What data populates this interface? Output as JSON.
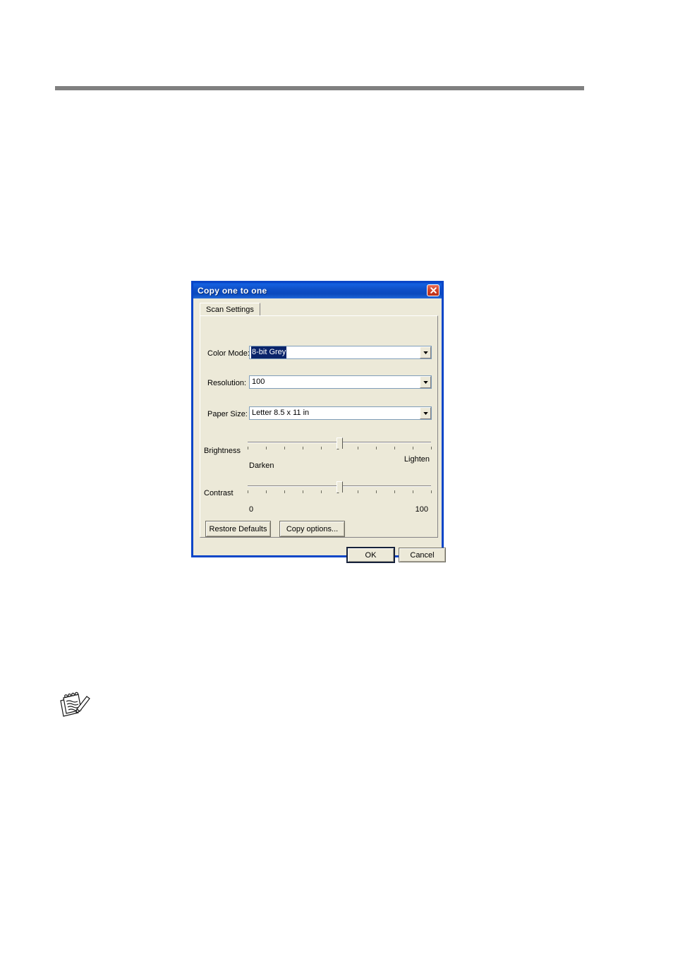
{
  "page": {
    "rule_color": "#808080",
    "background": "#ffffff",
    "note_icon": "notepad-pencil-icon"
  },
  "dialog": {
    "title": "Copy one to one",
    "close_icon": "close-icon",
    "accent_titlebar": "#0b49bd",
    "face_color": "#ece9d8",
    "tabs": [
      {
        "label": "Scan Settings",
        "active": true
      }
    ],
    "fields": [
      {
        "label": "Color Mode:",
        "value": "8-bit Grey",
        "selected": true,
        "control": "combobox",
        "arrow_icon": "chevron-down-icon"
      },
      {
        "label": "Resolution:",
        "value": "100",
        "selected": false,
        "control": "combobox",
        "arrow_icon": "chevron-down-icon"
      },
      {
        "label": "Paper Size:",
        "value": "Letter  8.5 x 11 in",
        "selected": false,
        "control": "combobox",
        "arrow_icon": "chevron-down-icon"
      }
    ],
    "sliders": [
      {
        "label": "Brightness",
        "min_caption": "Darken",
        "max_caption": "Lighten",
        "value": 50,
        "min": 0,
        "max": 100,
        "ticks": 11
      },
      {
        "label": "Contrast",
        "min_caption": "0",
        "max_caption": "100",
        "value": 50,
        "min": 0,
        "max": 100,
        "ticks": 11
      }
    ],
    "panel_buttons": [
      {
        "label": "Restore Defaults"
      },
      {
        "label": "Copy options..."
      }
    ],
    "footer_buttons": [
      {
        "label": "OK",
        "default": true
      },
      {
        "label": "Cancel",
        "default": false
      }
    ]
  }
}
